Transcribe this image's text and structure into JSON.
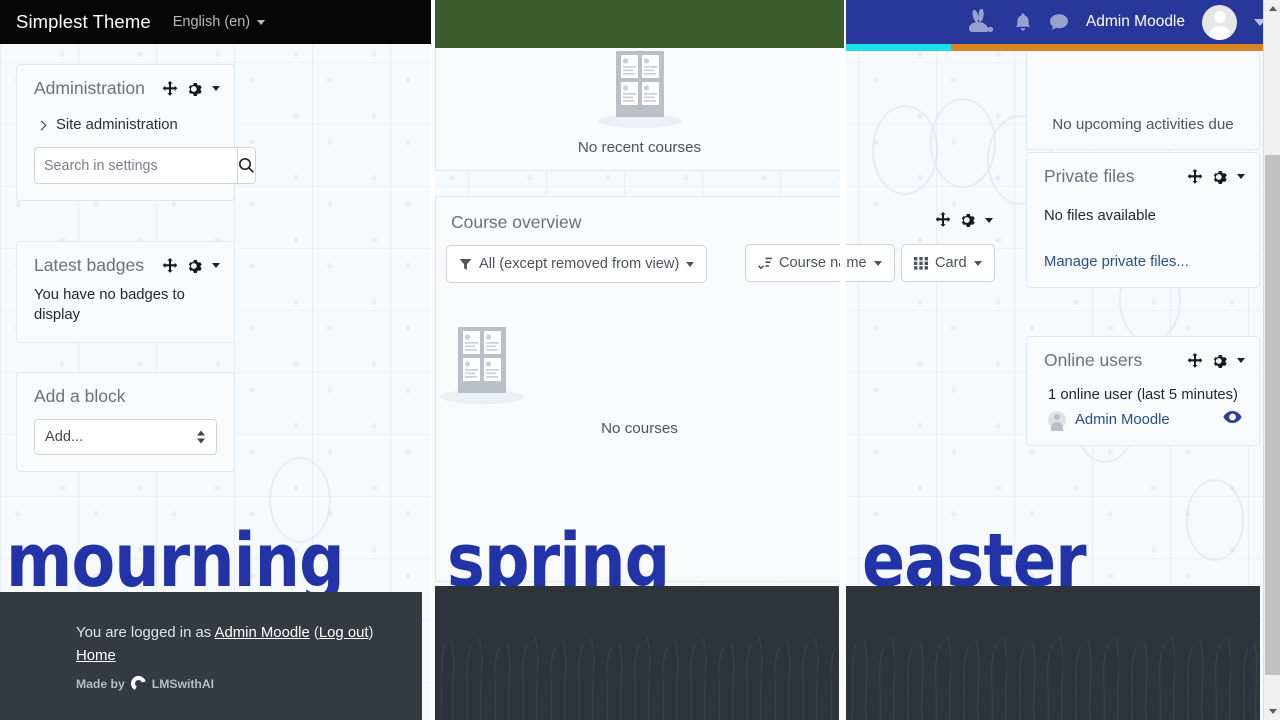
{
  "navbar": {
    "brand": "Simplest Theme",
    "language": "English (en)",
    "icons": [
      "bunny-icon",
      "bell-icon",
      "message-icon"
    ],
    "username": "Admin Moodle",
    "navbar_color": "#28389a",
    "brand_bar_color": "#060606",
    "accent_cyan": "#1ee0e8",
    "accent_orange": "#d98324"
  },
  "left_column": {
    "administration": {
      "title": "Administration",
      "site_administration": "Site administration",
      "search_placeholder": "Search in settings",
      "search_value": ""
    },
    "latest_badges": {
      "title": "Latest badges",
      "message": "You have no badges to display"
    },
    "add_a_block": {
      "title": "Add a block",
      "select_value": "Add..."
    }
  },
  "middle_column": {
    "recent_courses": {
      "empty_label": "No recent courses"
    },
    "course_overview": {
      "title": "Course overview",
      "filter_label": "All (except removed from view)",
      "sort_label": "Course name",
      "view_label": "Card",
      "empty_label": "No courses"
    }
  },
  "right_column": {
    "timeline": {
      "empty_label": "No upcoming activities due"
    },
    "private_files": {
      "title": "Private files",
      "empty_label": "No files available",
      "manage_link": "Manage private files..."
    },
    "online_users": {
      "title": "Online users",
      "count_text": "1 online user (last 5 minutes)",
      "user_name": "Admin Moodle"
    }
  },
  "overlay_words": {
    "word_1": "mourning",
    "word_2": "spring",
    "word_3": "easter",
    "color": "#2233a8"
  },
  "footer": {
    "logged_in_prefix": "You are logged in as ",
    "logged_in_user": "Admin Moodle",
    "logout_open": " (",
    "logout_label": "Log out",
    "logout_close": ")",
    "home_label": "Home",
    "made_by_label": "Made by",
    "made_by_brand": "LMSwithAI"
  }
}
